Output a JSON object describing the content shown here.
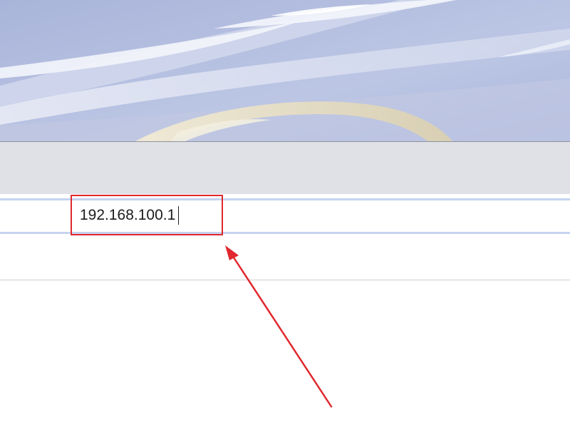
{
  "address_bar": {
    "value": "192.168.100.1"
  },
  "annotation": {
    "color": "#e0282e"
  },
  "colors": {
    "toolbar_background": "#dfe1e6",
    "address_border": "#c6d3f0"
  }
}
